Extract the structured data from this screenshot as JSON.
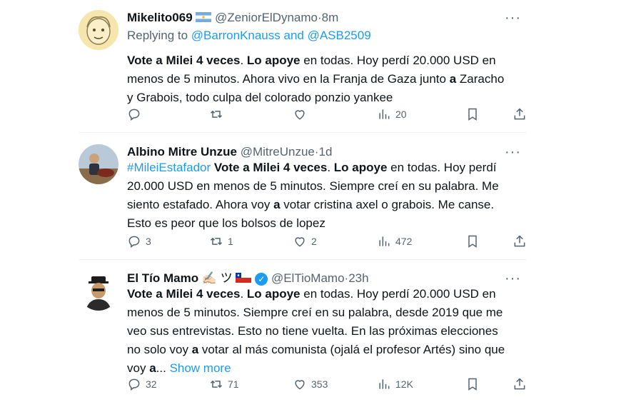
{
  "tweets": [
    {
      "display_name": "Mikelito069",
      "handle": "@ZeniorElDynamo",
      "sep": "·",
      "time": "8m",
      "more": "···",
      "replying_prefix": "Replying to ",
      "replying_users": "@BarronKnauss and @ASB2509",
      "text": {
        "b1": "Vote a Milei 4 veces",
        "t1": ". ",
        "b2": "Lo apoye",
        "t2": " en todas. Hoy perdí 20.000 USD en menos de 5 minutos. Ahora vivo en la Franja de Gaza junto ",
        "b3": "a",
        "t3": " Zaracho y Grabois, todo culpa del colorado ponzio yankee"
      },
      "actions": {
        "reply": "",
        "retweet": "",
        "like": "",
        "views": "20"
      }
    },
    {
      "display_name": "Albino Mitre Unzue",
      "handle": "@MitreUnzue",
      "sep": "·",
      "time": "1d",
      "more": "···",
      "text": {
        "hashtag": "#MileiEstafador",
        "t0": " ",
        "b1": "Vote a Milei 4 veces",
        "t1": ". ",
        "b2": "Lo apoye",
        "t2": " en todas. Hoy perdí 20.000 USD en menos de 5 minutos. Siempre creí en su palabra. Me siento estafado. Ahora voy ",
        "b3": "a",
        "t3": " votar cristina axel o grabois. Me canse. Esto es peor que los bolsos de lopez"
      },
      "actions": {
        "reply": "3",
        "retweet": "1",
        "like": "2",
        "views": "472"
      }
    },
    {
      "display_name": "El Tío Mamo",
      "name_emoji": "✍🏻 ツ",
      "handle": "@ElTioMamo",
      "sep": "·",
      "time": "23h",
      "more": "···",
      "text": {
        "b1": "Vote a Milei 4 veces",
        "t1": ". ",
        "b2": "Lo apoye",
        "t2": " en todas. Hoy perdí 20.000 USD en menos de 5 minutos. Siempre creí en su palabra, desde 2019 que me veo sus entrevistas. Esto no tiene vuelta. En las próximas elecciones no solo voy ",
        "b3": "a",
        "t3": " votar al más comunista (ojalá el profesor Artés) sino que voy ",
        "b4": "a",
        "t4": "... ",
        "show_more": "Show more"
      },
      "actions": {
        "reply": "32",
        "retweet": "71",
        "like": "353",
        "views": "12K"
      }
    }
  ],
  "icons": [
    "reply-icon",
    "retweet-icon",
    "like-icon",
    "views-icon",
    "bookmark-icon",
    "share-icon",
    "verified-icon"
  ],
  "colors": {
    "link": "#1d9bf0",
    "secondary": "#536471",
    "text": "#0f1419",
    "divider": "#eff3f4"
  }
}
